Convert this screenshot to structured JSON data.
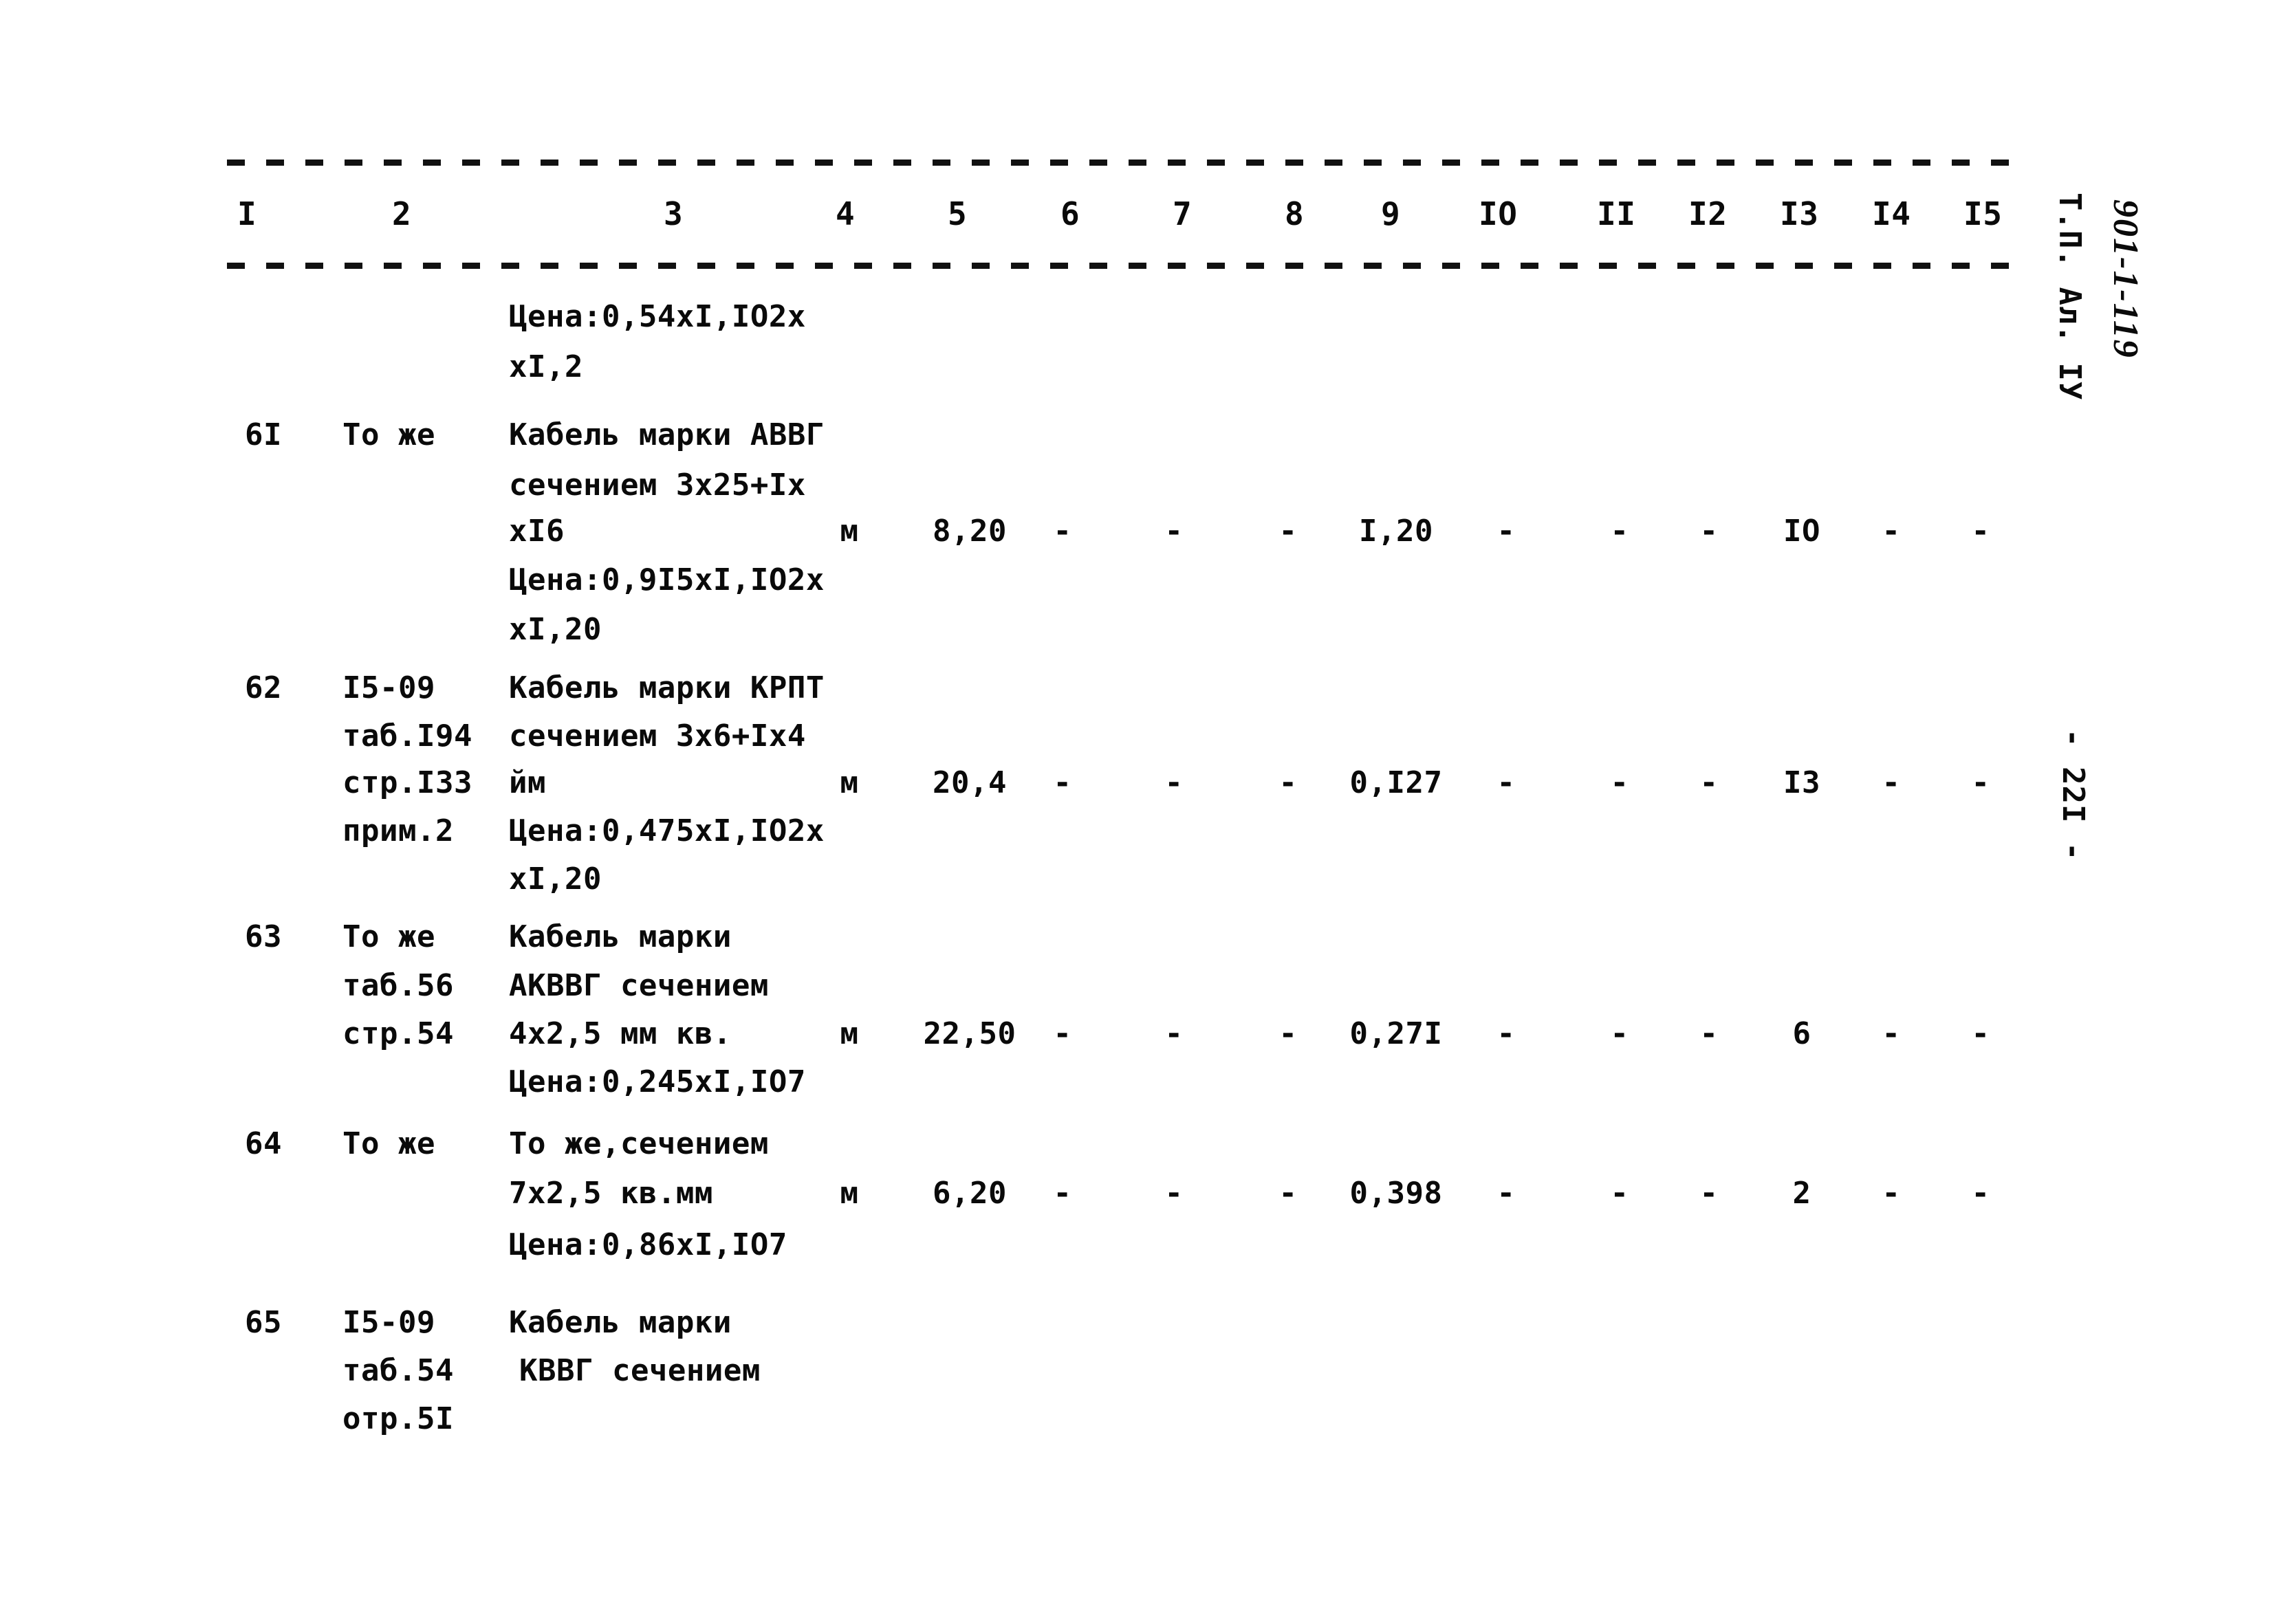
{
  "document": {
    "page_number_marker": "- 22I -",
    "margin_stamp": "Т.П. Ал. IУ",
    "margin_handwritten_code": "901-1-119"
  },
  "table": {
    "column_headers": [
      "I",
      "2",
      "3",
      "4",
      "5",
      "6",
      "7",
      "8",
      "9",
      "IO",
      "II",
      "I2",
      "I3",
      "I4",
      "I5"
    ],
    "top_rule": true,
    "header_rule": true,
    "continuation_row": {
      "col3_lines": [
        "Цена:0,54хI,IO2х",
        "хI,2"
      ]
    },
    "rows": [
      {
        "num": "6I",
        "col2_lines": [
          "То же"
        ],
        "col3_lines": [
          "Кабель марки АВВГ",
          "сечением 3х25+Iх",
          "хI6",
          "Цена:0,9I5хI,IO2х",
          "хI,20"
        ],
        "value_line_index": 2,
        "unit": "м",
        "col5": "8,20",
        "col6": "-",
        "col7": "-",
        "col8": "-",
        "col9": "I,20",
        "col10": "-",
        "col11": "-",
        "col12": "-",
        "col13": "IO",
        "col14": "-",
        "col15": "-"
      },
      {
        "num": "62",
        "col2_lines": [
          "I5-09",
          "таб.I94",
          "стр.I33",
          "прим.2"
        ],
        "col3_lines": [
          "Кабель марки КРПТ",
          "сечением 3х6+Iх4",
          "йм",
          "Цена:0,475хI,IO2х",
          "хI,20"
        ],
        "value_line_index": 2,
        "unit": "м",
        "col5": "20,4",
        "col6": "-",
        "col7": "-",
        "col8": "-",
        "col9": "0,I27",
        "col10": "-",
        "col11": "-",
        "col12": "-",
        "col13": "I3",
        "col14": "-",
        "col15": "-"
      },
      {
        "num": "63",
        "col2_lines": [
          "То же",
          "таб.56",
          "стр.54"
        ],
        "col3_lines": [
          "Кабель марки",
          "АКВВГ сечением",
          "4х2,5 мм кв.",
          "Цена:0,245хI,IO7"
        ],
        "value_line_index": 2,
        "unit": "м",
        "col5": "22,50",
        "col6": "-",
        "col7": "-",
        "col8": "-",
        "col9": "0,27I",
        "col10": "-",
        "col11": "-",
        "col12": "-",
        "col13": "6",
        "col14": "-",
        "col15": "-"
      },
      {
        "num": "64",
        "col2_lines": [
          "То же"
        ],
        "col3_lines": [
          "То же,сечением",
          "7х2,5 кв.мм",
          "Цена:0,86хI,IO7"
        ],
        "value_line_index": 1,
        "unit": "м",
        "col5": "6,20",
        "col6": "-",
        "col7": "-",
        "col8": "-",
        "col9": "0,398",
        "col10": "-",
        "col11": "-",
        "col12": "-",
        "col13": "2",
        "col14": "-",
        "col15": "-"
      },
      {
        "num": "65",
        "col2_lines": [
          "I5-09",
          "таб.54",
          "отр.5I"
        ],
        "col3_lines": [
          "Кабель марки",
          "КВВГ сечением"
        ],
        "value_line_index": -1,
        "unit": "",
        "col5": "",
        "col6": "",
        "col7": "",
        "col8": "",
        "col9": "",
        "col10": "",
        "col11": "",
        "col12": "",
        "col13": "",
        "col14": "",
        "col15": ""
      }
    ]
  }
}
